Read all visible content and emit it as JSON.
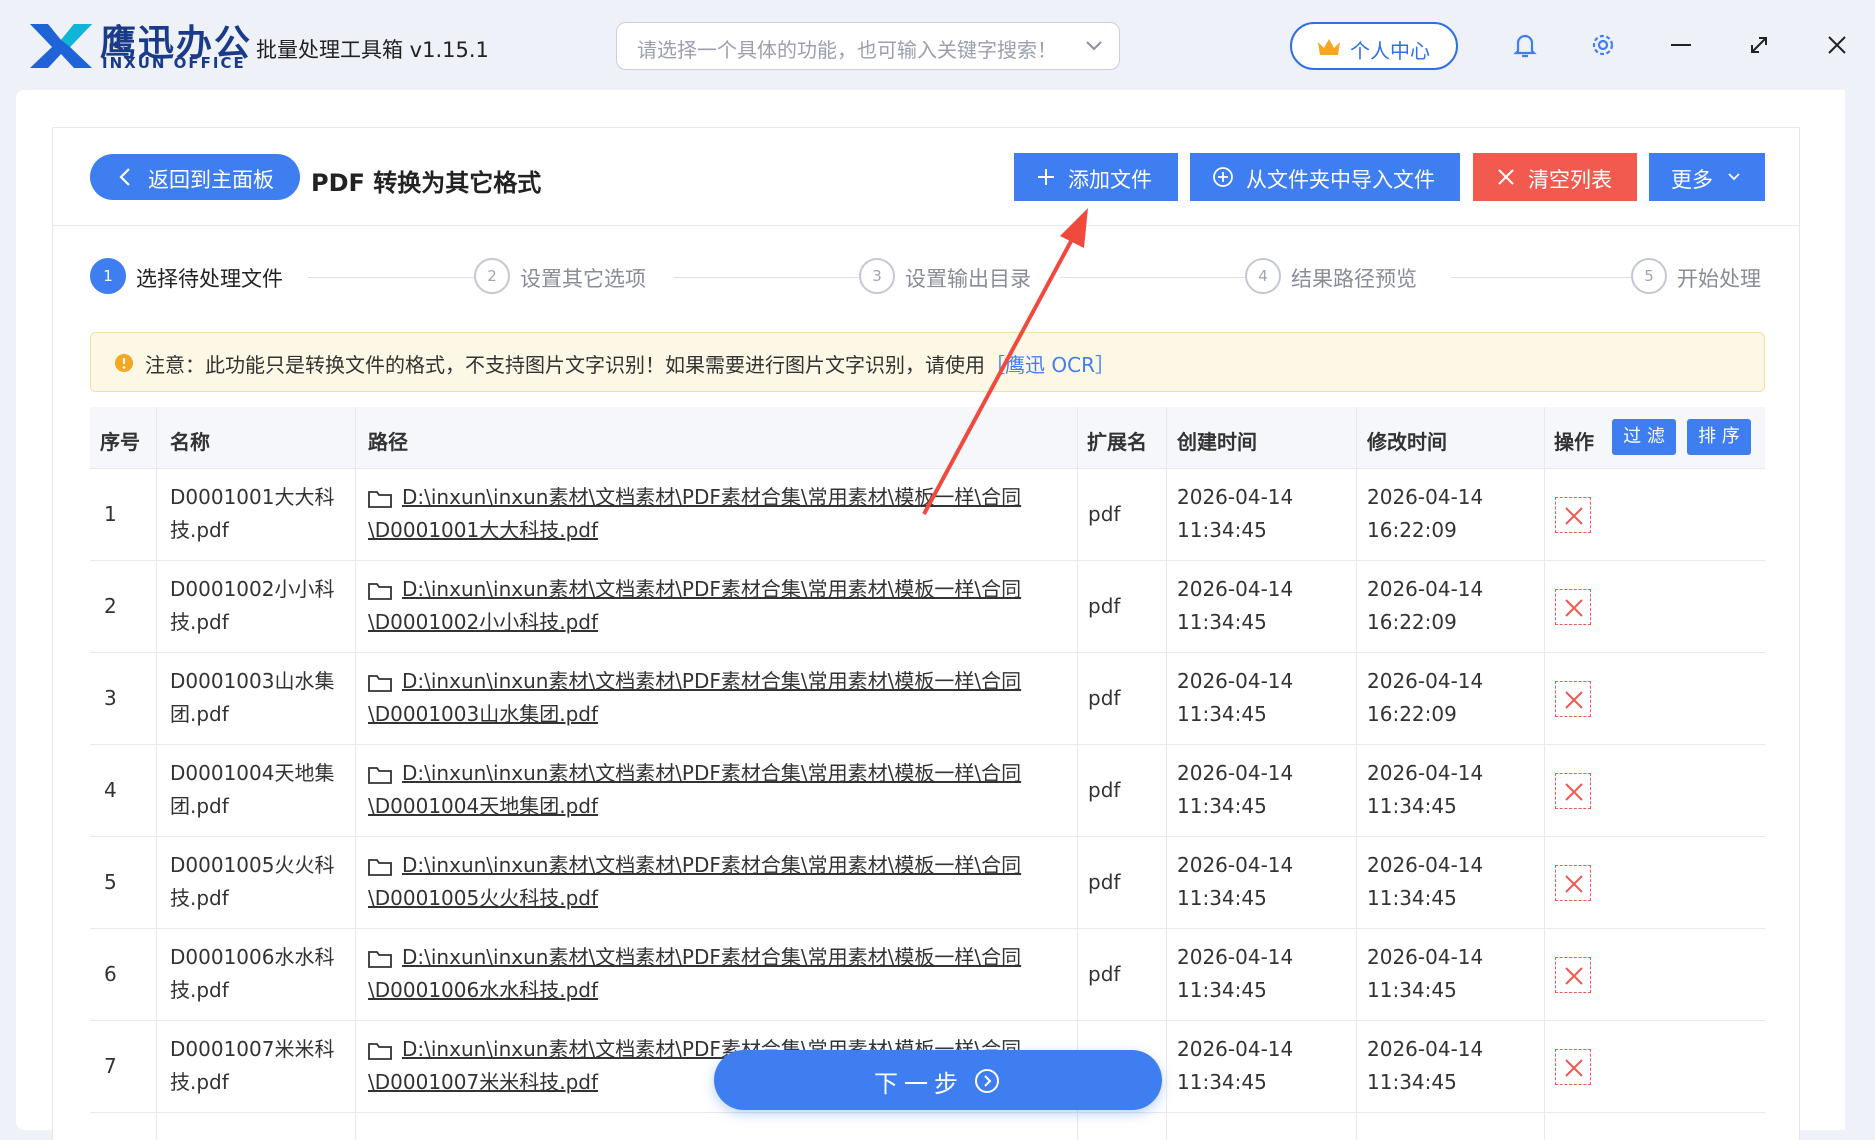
{
  "window": {
    "logo_cn": "鹰迅办公",
    "logo_en": "INXUN OFFICE",
    "app_title": "批量处理工具箱 v1.15.1",
    "search_placeholder": "请选择一个具体的功能，也可输入关键字搜索！",
    "user_center": "个人中心",
    "icons": [
      "bell-icon",
      "gear-icon",
      "minimize-icon",
      "maximize-icon",
      "close-icon"
    ]
  },
  "header": {
    "back_label": "返回到主面板",
    "page_title": "PDF 转换为其它格式",
    "add_file": "添加文件",
    "import_folder": "从文件夹中导入文件",
    "clear_list": "清空列表",
    "more": "更多"
  },
  "steps": [
    {
      "num": "1",
      "label": "选择待处理文件",
      "active": true
    },
    {
      "num": "2",
      "label": "设置其它选项",
      "active": false
    },
    {
      "num": "3",
      "label": "设置输出目录",
      "active": false
    },
    {
      "num": "4",
      "label": "结果路径预览",
      "active": false
    },
    {
      "num": "5",
      "label": "开始处理",
      "active": false
    }
  ],
  "notice": {
    "text": "注意：此功能只是转换文件的格式，不支持图片文字识别！如果需要进行图片文字识别，请使用",
    "link": "［鹰迅 OCR］"
  },
  "table": {
    "columns": {
      "index": "序号",
      "name": "名称",
      "path": "路径",
      "ext": "扩展名",
      "created": "创建时间",
      "modified": "修改时间",
      "ops": "操作"
    },
    "filter_label": "过 滤",
    "sort_label": "排 序",
    "rows": [
      {
        "index": "1",
        "name": "D0001001大大科技.pdf",
        "path": "D:\\inxun\\inxun素材\\文档素材\\PDF素材合集\\常用素材\\模板一样\\合同\\D0001001大大科技.pdf",
        "ext": "pdf",
        "created": "2026-04-14 11:34:45",
        "modified": "2026-04-14 16:22:09"
      },
      {
        "index": "2",
        "name": "D0001002小小科技.pdf",
        "path": "D:\\inxun\\inxun素材\\文档素材\\PDF素材合集\\常用素材\\模板一样\\合同\\D0001002小小科技.pdf",
        "ext": "pdf",
        "created": "2026-04-14 11:34:45",
        "modified": "2026-04-14 16:22:09"
      },
      {
        "index": "3",
        "name": "D0001003山水集团.pdf",
        "path": "D:\\inxun\\inxun素材\\文档素材\\PDF素材合集\\常用素材\\模板一样\\合同\\D0001003山水集团.pdf",
        "ext": "pdf",
        "created": "2026-04-14 11:34:45",
        "modified": "2026-04-14 16:22:09"
      },
      {
        "index": "4",
        "name": "D0001004天地集团.pdf",
        "path": "D:\\inxun\\inxun素材\\文档素材\\PDF素材合集\\常用素材\\模板一样\\合同\\D0001004天地集团.pdf",
        "ext": "pdf",
        "created": "2026-04-14 11:34:45",
        "modified": "2026-04-14 11:34:45"
      },
      {
        "index": "5",
        "name": "D0001005火火科技.pdf",
        "path": "D:\\inxun\\inxun素材\\文档素材\\PDF素材合集\\常用素材\\模板一样\\合同\\D0001005火火科技.pdf",
        "ext": "pdf",
        "created": "2026-04-14 11:34:45",
        "modified": "2026-04-14 11:34:45"
      },
      {
        "index": "6",
        "name": "D0001006水水科技.pdf",
        "path": "D:\\inxun\\inxun素材\\文档素材\\PDF素材合集\\常用素材\\模板一样\\合同\\D0001006水水科技.pdf",
        "ext": "pdf",
        "created": "2026-04-14 11:34:45",
        "modified": "2026-04-14 11:34:45"
      },
      {
        "index": "7",
        "name": "D0001007米米科技.pdf",
        "path": "D:\\inxun\\inxun素材\\文档素材\\PDF素材合集\\常用素材\\模板一样\\合同\\D0001007米米科技.pdf",
        "ext": "pdf",
        "created": "2026-04-14 11:34:45",
        "modified": "2026-04-14 11:34:45"
      }
    ]
  },
  "footer": {
    "next_label": "下一步"
  },
  "colors": {
    "primary": "#3f7ef0",
    "danger": "#f25a4f",
    "notice_bg": "#fdf8e6"
  }
}
